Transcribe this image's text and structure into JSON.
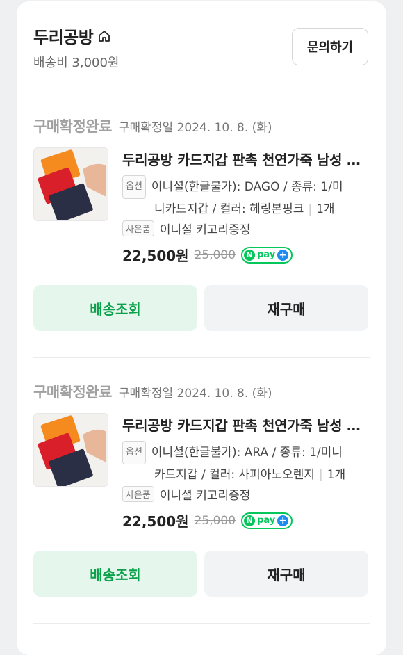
{
  "store": {
    "name": "두리공방",
    "home_icon": "home-icon",
    "shipping": "배송비 3,000원",
    "inquiry_label": "문의하기"
  },
  "orders": [
    {
      "status": "구매확정완료",
      "confirm_date": "구매확정일 2024. 10. 8. (화)",
      "title": "두리공방 카드지갑 판촉 천연가죽 남성 여성 이니셜 각인 명함지갑",
      "option_tag": "옵션",
      "option_line1": "이니셜(한글불가): DAGO / 종류: 1/미",
      "option_line2": "니카드지갑 / 컬러: 헤링본핑크",
      "quantity": "1개",
      "gift_tag": "사은품",
      "gift_text": "이니셜 키고리증정",
      "price": "22,500원",
      "original_price": "25,000",
      "track_label": "배송조회",
      "reorder_label": "재구매"
    },
    {
      "status": "구매확정완료",
      "confirm_date": "구매확정일 2024. 10. 8. (화)",
      "title": "두리공방 카드지갑 판촉 천연가죽 남성 여성 이니셜 각인 명함지갑",
      "option_tag": "옵션",
      "option_line1": "이니셜(한글불가): ARA / 종류: 1/미니",
      "option_line2": "카드지갑 / 컬러: 사피아노오렌지",
      "quantity": "1개",
      "gift_tag": "사은품",
      "gift_text": "이니셜 키고리증정",
      "price": "22,500원",
      "original_price": "25,000",
      "track_label": "배송조회",
      "reorder_label": "재구매"
    }
  ],
  "npay": {
    "n": "N",
    "text": "pay",
    "plus": "+"
  },
  "colors": {
    "accent_green": "#03c75a",
    "track_bg": "#e5f6ec",
    "track_text": "#0aa14a"
  }
}
